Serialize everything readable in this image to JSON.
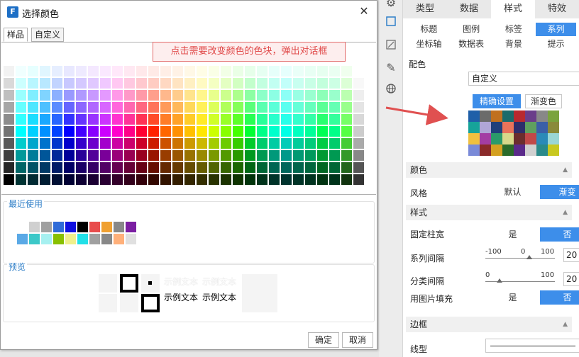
{
  "dialog": {
    "title": "选择颜色",
    "tabs": [
      "样品",
      "自定义"
    ],
    "callout": "点击需要改变颜色的色块，弹出对话框",
    "recent_title": "最近使用",
    "preview_title": "预览",
    "preview_sample_text": "示例文本",
    "ok_label": "确定",
    "cancel_label": "取消",
    "grid_colors": [
      [
        "#f2f2f2",
        "#f0ffff",
        "#e6ffff",
        "#e0f6ff",
        "#e6eeff",
        "#e8e8ff",
        "#eeeaff",
        "#f4e8ff",
        "#fae8ff",
        "#ffe8fa",
        "#ffe8f2",
        "#ffe8ea",
        "#ffeae6",
        "#ffeee6",
        "#fff2e6",
        "#fff8e6",
        "#fffde6",
        "#faffe6",
        "#f2ffe6",
        "#eaffe6",
        "#e6ffea",
        "#e6fff2",
        "#e6fffa",
        "#e6fffd",
        "#eafff8",
        "#e8fff4",
        "#e6fff0",
        "#eafff2",
        "#f0ffee",
        "#ffffff"
      ],
      [
        "#d9d9d9",
        "#ccffff",
        "#b8f6ff",
        "#b8e8ff",
        "#c2d4ff",
        "#c8c8ff",
        "#d4c8ff",
        "#e0c8ff",
        "#f0c8ff",
        "#ffc8f2",
        "#ffc8e0",
        "#ffc8ce",
        "#ffccc2",
        "#ffd8c2",
        "#ffe4c2",
        "#fff0c2",
        "#fffac2",
        "#f4ffc2",
        "#e4ffc2",
        "#d2ffc2",
        "#c2ffcc",
        "#c2ffe0",
        "#c2fff2",
        "#c2fffa",
        "#c8fff0",
        "#c8ffe6",
        "#c2ffdc",
        "#ccffe4",
        "#dcffd6",
        "#f8f8f8"
      ],
      [
        "#bfbfbf",
        "#99ffff",
        "#80eeff",
        "#80d4ff",
        "#8cb0ff",
        "#9999ff",
        "#b099ff",
        "#c899ff",
        "#e499ff",
        "#ff99e8",
        "#ff99c8",
        "#ff99a8",
        "#ff9f8c",
        "#ffb88c",
        "#ffcc8c",
        "#ffe48c",
        "#fff68c",
        "#e8ff8c",
        "#ccff8c",
        "#adff8c",
        "#8cffa3",
        "#8cffc8",
        "#8cffe4",
        "#8cfff6",
        "#99ffe4",
        "#99ffd0",
        "#8cffb8",
        "#99ffcc",
        "#bbffb0",
        "#eeeeee"
      ],
      [
        "#a6a6a6",
        "#66ffff",
        "#4de6ff",
        "#4dc0ff",
        "#5a8cff",
        "#6666ff",
        "#8c66ff",
        "#b066ff",
        "#d866ff",
        "#ff66dc",
        "#ff66b0",
        "#ff6680",
        "#ff735a",
        "#ff9a5a",
        "#ffb85a",
        "#ffd85a",
        "#fff05a",
        "#dcff5a",
        "#b0ff5a",
        "#85ff5a",
        "#5aff7a",
        "#5affb0",
        "#5affd8",
        "#5afff0",
        "#66ffd8",
        "#66ffbc",
        "#5aff96",
        "#66ffb4",
        "#99ff8c",
        "#e4e4e4"
      ],
      [
        "#8c8c8c",
        "#33ffff",
        "#1addff",
        "#1aa8ff",
        "#2866ff",
        "#3333ff",
        "#6633ff",
        "#9933ff",
        "#cc33ff",
        "#ff33d0",
        "#ff3399",
        "#ff3355",
        "#ff4a28",
        "#ff7d28",
        "#ffa228",
        "#ffcc28",
        "#ffea28",
        "#d0ff28",
        "#99ff28",
        "#5cff28",
        "#28ff52",
        "#28ff99",
        "#28ffcc",
        "#28ffea",
        "#33ffcc",
        "#33ffa8",
        "#28ff70",
        "#33ff9c",
        "#77ff66",
        "#d8d8d8"
      ],
      [
        "#737373",
        "#00ffff",
        "#00d0ff",
        "#0090ff",
        "#0044ff",
        "#0000ff",
        "#4400ff",
        "#8800ff",
        "#cc00ff",
        "#ff00cc",
        "#ff0088",
        "#ff0033",
        "#ff2200",
        "#ff6600",
        "#ff9000",
        "#ffc000",
        "#ffe600",
        "#ccff00",
        "#88ff00",
        "#44ff00",
        "#00ff33",
        "#00ff88",
        "#00ffcc",
        "#00ffe6",
        "#00ffc0",
        "#00ff99",
        "#00ff55",
        "#00ff88",
        "#55ff44",
        "#cccccc"
      ],
      [
        "#595959",
        "#00cccc",
        "#00a6cc",
        "#0073cc",
        "#0036cc",
        "#0000cc",
        "#3600cc",
        "#6c00cc",
        "#a300cc",
        "#cc00a3",
        "#cc006c",
        "#cc0029",
        "#cc1b00",
        "#cc5100",
        "#cc7300",
        "#cc9a00",
        "#ccb800",
        "#a3cc00",
        "#6ccc00",
        "#36cc00",
        "#00cc29",
        "#00cc6c",
        "#00cca3",
        "#00ccb8",
        "#00cc9a",
        "#00cc7a",
        "#00cc44",
        "#00cc6c",
        "#44cc36",
        "#aaaaaa"
      ],
      [
        "#404040",
        "#009999",
        "#007d99",
        "#005699",
        "#002999",
        "#000099",
        "#290099",
        "#520099",
        "#7a0099",
        "#99007a",
        "#990052",
        "#99001f",
        "#991400",
        "#993d00",
        "#995600",
        "#997300",
        "#998a00",
        "#7a9900",
        "#529900",
        "#299900",
        "#00991f",
        "#009952",
        "#00997a",
        "#00998a",
        "#009973",
        "#00995c",
        "#009933",
        "#009952",
        "#339929",
        "#888888"
      ],
      [
        "#262626",
        "#006666",
        "#005366",
        "#003966",
        "#001b66",
        "#000066",
        "#1b0066",
        "#360066",
        "#520066",
        "#660052",
        "#660036",
        "#660014",
        "#660d00",
        "#662900",
        "#663900",
        "#664d00",
        "#665c00",
        "#526600",
        "#366600",
        "#1b6600",
        "#006614",
        "#006636",
        "#006652",
        "#00665c",
        "#00664d",
        "#00663d",
        "#006622",
        "#006636",
        "#22661b",
        "#555555"
      ],
      [
        "#000000",
        "#003333",
        "#002a33",
        "#001d33",
        "#000e33",
        "#000033",
        "#0e0033",
        "#1b0033",
        "#290033",
        "#330029",
        "#33001b",
        "#33000a",
        "#330700",
        "#331400",
        "#331d00",
        "#332600",
        "#332e00",
        "#293300",
        "#1b3300",
        "#0e3300",
        "#00330a",
        "#00331b",
        "#003329",
        "#00332e",
        "#003326",
        "#00331f",
        "#003311",
        "#00331b",
        "#11330e",
        "#333333"
      ]
    ],
    "recent_colors": [
      [
        "#ffffff",
        "#d0d0d0",
        "#a0a0a0",
        "#2f6bd8",
        "#1010e0",
        "#000000",
        "#e84c4c",
        "#f0a030",
        "#888888",
        "#7b1fa2"
      ],
      [
        "#5aa9e6",
        "#3cc8c8",
        "#a6f0f0",
        "#88c000",
        "#f0f08c",
        "#22e0e8",
        "#a0a0a0",
        "#888888",
        "#ffb07a",
        "#e0e0e0"
      ]
    ]
  },
  "panel": {
    "top_tabs": [
      "类型",
      "数据",
      "样式",
      "特效"
    ],
    "active_top_tab": "样式",
    "sub_tabs": [
      "标题",
      "图例",
      "标签",
      "系列",
      "坐标轴",
      "数据表",
      "背景",
      "提示"
    ],
    "active_sub_tab": "系列",
    "color_scheme_label": "配色",
    "color_scheme_value": "自定义",
    "precise_button": "精确设置",
    "gradient_button": "渐变色",
    "palette": [
      [
        "#1f5fa8",
        "#6b6b6b",
        "#c0701f",
        "#1a6b6b",
        "#b8292f",
        "#6a3d8a",
        "#888888",
        "#7aa33d"
      ],
      [
        "#16a39a",
        "#b0a6d6",
        "#1f3f7a",
        "#e8735a",
        "#2d2d6b",
        "#5fa05f",
        "#3a5fa8",
        "#8a8a3a"
      ],
      [
        "#f0c040",
        "#a33da3",
        "#2a9a6a",
        "#d8d88a",
        "#6b2d2d",
        "#c04848",
        "#2a8ab8",
        "#9ad6d6"
      ],
      [
        "#7a8ad8",
        "#8a2a2a",
        "#d4a020",
        "#2a6b2a",
        "#5a2a8a",
        "#d0d0d0",
        "#2a8a8a",
        "#c8c820"
      ]
    ],
    "section_color": "颜色",
    "style_label": "风格",
    "style_options": [
      "默认",
      "渐变"
    ],
    "section_style": "样式",
    "fixed_width_label": "固定柱宽",
    "yes": "是",
    "no": "否",
    "series_gap_label": "系列间隔",
    "series_gap_min": "-100",
    "series_gap_mid": "0",
    "series_gap_max": "100",
    "series_gap_value": "20",
    "category_gap_label": "分类间隔",
    "category_gap_min": "0",
    "category_gap_max": "100",
    "category_gap_value": "20",
    "image_fill_label": "用图片填充",
    "section_border": "边框",
    "line_type_label": "线型"
  }
}
